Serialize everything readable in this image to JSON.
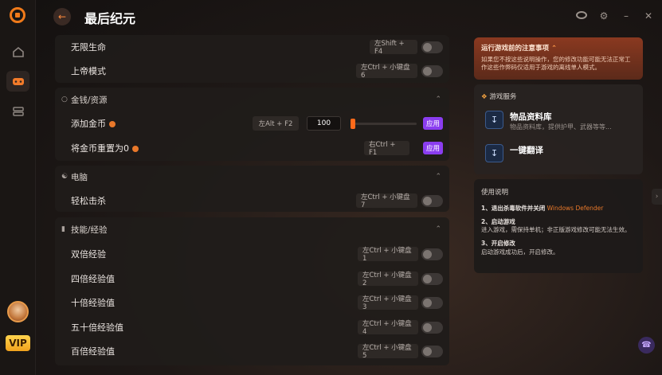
{
  "app": {
    "title": "最后纪元",
    "vip_label": "VIP"
  },
  "sidebar": {
    "items": [
      {
        "name": "home",
        "icon": "home-icon",
        "active": false
      },
      {
        "name": "games",
        "icon": "gamepad-icon",
        "active": true
      },
      {
        "name": "library",
        "icon": "library-icon",
        "active": false
      }
    ]
  },
  "cheats": {
    "top_rows": [
      {
        "label": "无限生命",
        "hotkey": "左Shift + F4"
      },
      {
        "label": "上帝模式",
        "hotkey": "左Ctrl + 小键盘6"
      }
    ],
    "money_section": {
      "title": "金钱/资源",
      "add_gold": {
        "label": "添加金币",
        "hotkey": "左Alt + F2",
        "value": "100",
        "slider_fraction": 0.0,
        "apply_label": "应用"
      },
      "reset_gold": {
        "label": "将金币重置为0",
        "hotkey": "右Ctrl + F1",
        "apply_label": "应用"
      }
    },
    "ai_section": {
      "title": "电脑",
      "rows": [
        {
          "label": "轻松击杀",
          "hotkey": "左Ctrl + 小键盘7"
        }
      ]
    },
    "skill_section": {
      "title": "技能/经验",
      "rows": [
        {
          "label": "双倍经验",
          "hotkey": "左Ctrl + 小键盘1"
        },
        {
          "label": "四倍经验值",
          "hotkey": "左Ctrl + 小键盘2"
        },
        {
          "label": "十倍经验值",
          "hotkey": "左Ctrl + 小键盘3"
        },
        {
          "label": "五十倍经验值",
          "hotkey": "左Ctrl + 小键盘4"
        },
        {
          "label": "百倍经验值",
          "hotkey": "左Ctrl + 小键盘5"
        }
      ]
    }
  },
  "notice": {
    "title": "运行游戏前的注意事项",
    "text": "如果您不按这些说明操作，您的修改功能可能无法正常工作这些作弊码仅适用于游戏的离线单人模式。"
  },
  "services": {
    "title": "游戏服务",
    "items": [
      {
        "title": "物品资料库",
        "subtitle": "物品资料库，提供护甲、武器等等..."
      },
      {
        "title": "一键翻译",
        "subtitle": ""
      }
    ]
  },
  "usage": {
    "title": "使用说明",
    "steps": [
      {
        "heading": "1、退出杀毒软件并关闭",
        "highlight": "Windows Defender",
        "body": ""
      },
      {
        "heading": "2、启动游戏",
        "highlight": "",
        "body": "进入游戏，需保持单机；非正版游戏修改可能无法生效。"
      },
      {
        "heading": "3、开启修改",
        "highlight": "",
        "body": "启动游戏成功后，开启修改。"
      }
    ]
  },
  "colors": {
    "accent": "#f07a1a",
    "apply_button": "#8a3df0",
    "notice_bg": "#8a3920"
  }
}
